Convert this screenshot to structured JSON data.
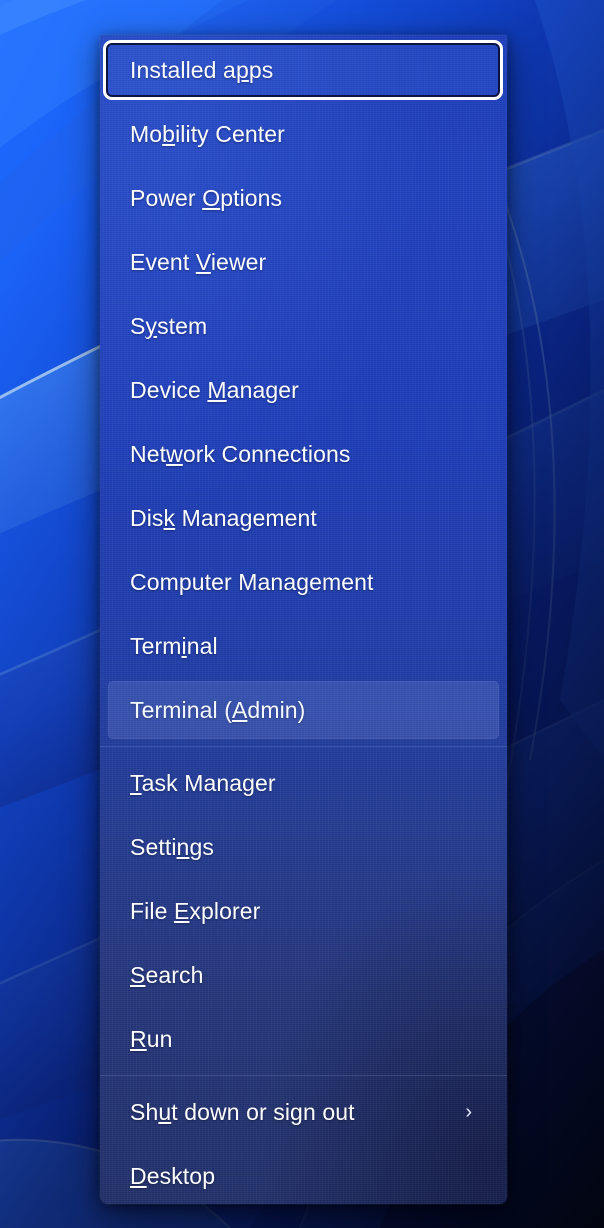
{
  "desktop": {
    "wallpaper_name": "windows-11-bloom-wallpaper",
    "colors": {
      "blue_bright": "#2f7bff",
      "blue_mid": "#1450e0",
      "blue_deep": "#0a1f8c",
      "blue_dark": "#07103f",
      "highlight_cyan": "#9fd4ff",
      "near_black": "#04061c"
    }
  },
  "menu": {
    "name": "Windows Quick Link menu",
    "accent_focus_color": "#ffffff",
    "text_color": "#ffffff",
    "background_top_color": "#1c3bb5",
    "background_bottom_color": "#1f2d66",
    "items": [
      {
        "id": "installed-apps",
        "label": "Installed apps",
        "pre": "Installed a",
        "accel": "p",
        "post": "ps",
        "state": "focused",
        "submenu": false
      },
      {
        "id": "mobility-center",
        "label": "Mobility Center",
        "pre": "Mo",
        "accel": "b",
        "post": "ility Center",
        "state": "normal",
        "submenu": false
      },
      {
        "id": "power-options",
        "label": "Power Options",
        "pre": "Power ",
        "accel": "O",
        "post": "ptions",
        "state": "normal",
        "submenu": false
      },
      {
        "id": "event-viewer",
        "label": "Event Viewer",
        "pre": "Event ",
        "accel": "V",
        "post": "iewer",
        "state": "normal",
        "submenu": false
      },
      {
        "id": "system",
        "label": "System",
        "pre": "S",
        "accel": "y",
        "post": "stem",
        "state": "normal",
        "submenu": false
      },
      {
        "id": "device-manager",
        "label": "Device Manager",
        "pre": "Device ",
        "accel": "M",
        "post": "anager",
        "state": "normal",
        "submenu": false
      },
      {
        "id": "network-connections",
        "label": "Network Connections",
        "pre": "Net",
        "accel": "w",
        "post": "ork Connections",
        "state": "normal",
        "submenu": false
      },
      {
        "id": "disk-management",
        "label": "Disk Management",
        "pre": "Dis",
        "accel": "k",
        "post": " Management",
        "state": "normal",
        "submenu": false
      },
      {
        "id": "computer-management",
        "label": "Computer Management",
        "pre": "Computer Mana",
        "accel": "g",
        "post": "ement",
        "state": "normal",
        "submenu": false
      },
      {
        "id": "terminal",
        "label": "Terminal",
        "pre": "Term",
        "accel": "i",
        "post": "nal",
        "state": "normal",
        "submenu": false
      },
      {
        "id": "terminal-admin",
        "label": "Terminal (Admin)",
        "pre": "Terminal (",
        "accel": "A",
        "post": "dmin)",
        "state": "hovered",
        "submenu": false
      },
      {
        "id": "task-manager",
        "label": "Task Manager",
        "pre": "",
        "accel": "T",
        "post": "ask Manager",
        "state": "normal",
        "submenu": false
      },
      {
        "id": "settings",
        "label": "Settings",
        "pre": "Setti",
        "accel": "n",
        "post": "gs",
        "state": "normal",
        "submenu": false
      },
      {
        "id": "file-explorer",
        "label": "File Explorer",
        "pre": "File ",
        "accel": "E",
        "post": "xplorer",
        "state": "normal",
        "submenu": false
      },
      {
        "id": "search",
        "label": "Search",
        "pre": "",
        "accel": "S",
        "post": "earch",
        "state": "normal",
        "submenu": false
      },
      {
        "id": "run",
        "label": "Run",
        "pre": "",
        "accel": "R",
        "post": "un",
        "state": "normal",
        "submenu": false
      },
      {
        "id": "shut-down-or-sign-out",
        "label": "Shut down or sign out",
        "pre": "Sh",
        "accel": "u",
        "post": "t down or sign out",
        "state": "normal",
        "submenu": true,
        "submenu_glyph": "›"
      },
      {
        "id": "desktop",
        "label": "Desktop",
        "pre": "",
        "accel": "D",
        "post": "esktop",
        "state": "normal",
        "submenu": false
      }
    ],
    "separator_after_item_ids": [
      "terminal-admin",
      "run"
    ]
  }
}
